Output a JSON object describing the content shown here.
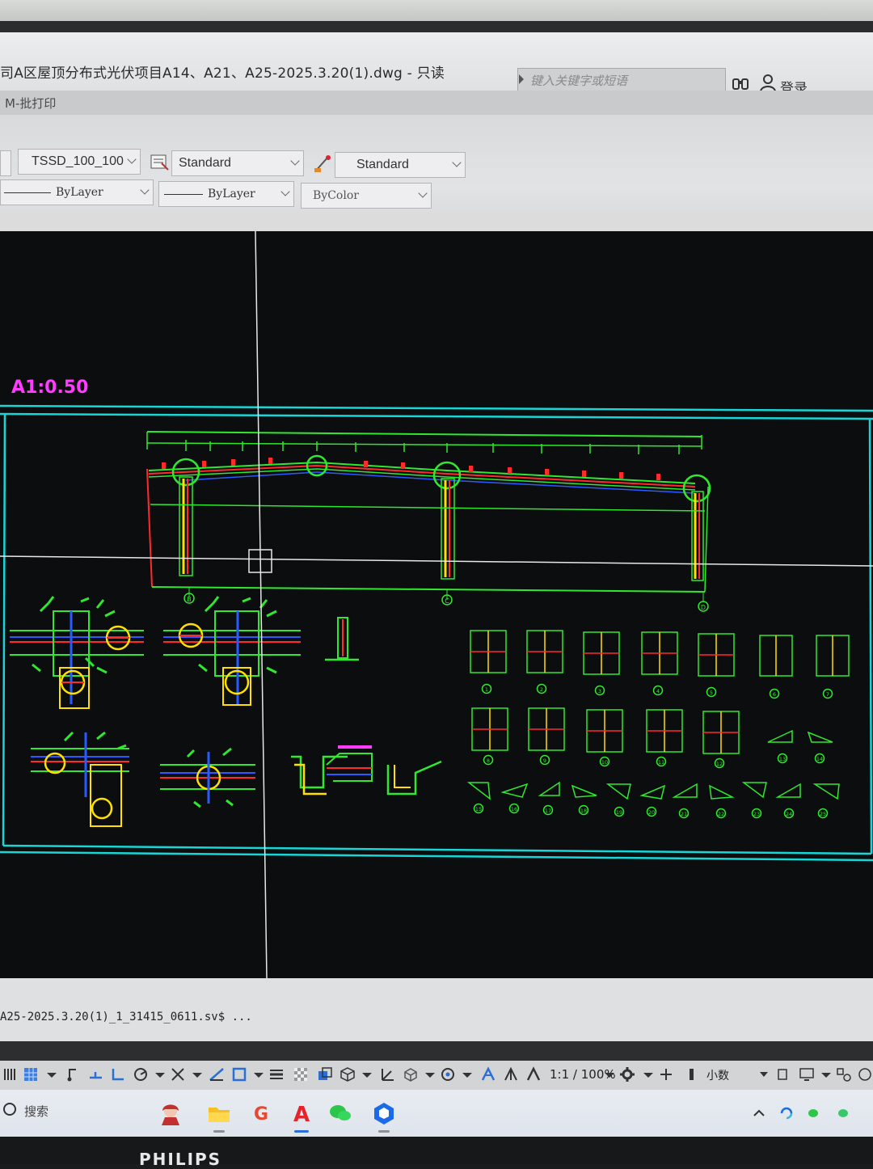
{
  "window": {
    "title": "司A区屋顶分布式光伏项目A14、A21、A25-2025.3.20(1).dwg - 只读",
    "menu_label": "M-批打印",
    "search_placeholder": "键入关键字或短语",
    "login_label": "登录"
  },
  "ribbon": {
    "layer_combo": "TSSD_100_100",
    "text_style_combo": "Standard",
    "dim_style_combo": "Standard",
    "linetype_combo": "ByLayer",
    "lineweight_combo": "ByLayer",
    "color_combo": "ByColor"
  },
  "drawing": {
    "section_label": "A1:0.50",
    "grid_labels": [
      "B",
      "C",
      "D"
    ],
    "detail_numbers": [
      "1",
      "2",
      "3",
      "4",
      "5",
      "6",
      "7",
      "8",
      "9",
      "10",
      "11",
      "12",
      "13",
      "14",
      "15",
      "16",
      "17",
      "18",
      "19",
      "20",
      "21",
      "22",
      "23",
      "24",
      "25"
    ],
    "accent_colors": {
      "frame": "#19d6d6",
      "steel": "#2fe82f",
      "member": "#ffe000",
      "rebar": "#ff2a2a",
      "bolt": "#2a5bff",
      "highlight": "#ff3cff"
    }
  },
  "command_line": {
    "text": "A25-2025.3.20(1)_1_31415_0611.sv$ ..."
  },
  "status_bar": {
    "zoom": "1:1 / 100%",
    "units": "小数"
  },
  "taskbar": {
    "search_label": "搜索"
  },
  "monitor": {
    "brand": "PHILIPS"
  }
}
